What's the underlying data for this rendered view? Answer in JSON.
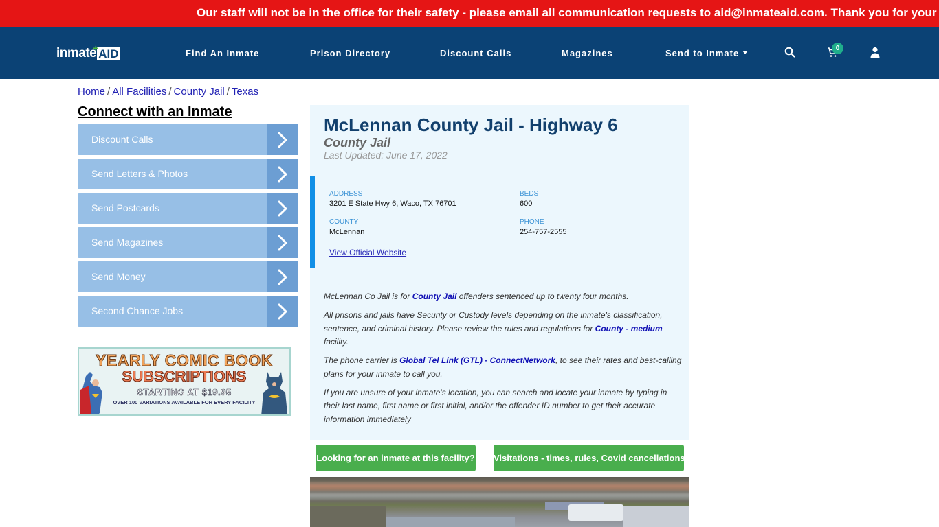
{
  "alert": {
    "text": "Our staff will not be in the office for their safety - please email all communication requests to aid@inmateaid.com. Thank you for your understanding."
  },
  "header": {
    "logo_text_a": "inmate",
    "logo_text_b": "AID",
    "nav": [
      {
        "label": "Find An Inmate"
      },
      {
        "label": "Prison Directory"
      },
      {
        "label": "Discount Calls"
      },
      {
        "label": "Magazines"
      },
      {
        "label": "Send to Inmate",
        "has_dropdown": true
      }
    ],
    "icons": {
      "search": "search-icon",
      "cart": "cart-icon",
      "user": "user-icon"
    },
    "cart_count": "0"
  },
  "breadcrumb": [
    {
      "label": "Home"
    },
    {
      "label": "All Facilities"
    },
    {
      "label": "County Jail"
    },
    {
      "label": "Texas"
    }
  ],
  "sidebar": {
    "title": "Connect with an Inmate",
    "items": [
      {
        "label": "Discount Calls"
      },
      {
        "label": "Send Letters & Photos"
      },
      {
        "label": "Send Postcards"
      },
      {
        "label": "Send Magazines"
      },
      {
        "label": "Send Money"
      },
      {
        "label": "Second Chance Jobs"
      }
    ],
    "banner": {
      "line1": "YEARLY COMIC BOOK",
      "line2": "SUBSCRIPTIONS",
      "line3": "STARTING AT $19.95",
      "line4": "OVER 100 VARIATIONS AVAILABLE FOR EVERY FACILITY"
    }
  },
  "facility": {
    "name": "McLennan County Jail - Highway 6",
    "type": "County Jail",
    "last_updated": "Last Updated: June 17, 2022",
    "address_label": "ADDRESS",
    "address": "3201 E State Hwy 6, Waco, TX 76701",
    "beds_label": "BEDS",
    "beds": "600",
    "county_label": "COUNTY",
    "county": "McLennan",
    "phone_label": "PHONE",
    "phone": "254-757-2555",
    "website_link": "View Official Website"
  },
  "description": {
    "p1_a": "McLennan Co Jail is for ",
    "p1_link": "County Jail",
    "p1_b": " offenders sentenced up to twenty four months.",
    "p2_a": "All prisons and jails have Security or Custody levels depending on the inmate's classification, sentence, and criminal history. Please review the rules and regulations for ",
    "p2_link": "County - medium",
    "p2_b": " facility.",
    "p3_a": "The phone carrier is ",
    "p3_link": "Global Tel Link (GTL) - ConnectNetwork",
    "p3_b": ", to see their rates and best-calling plans for your inmate to call you.",
    "p4": "If you are unsure of your inmate's location, you can search and locate your inmate by typing in their last name, first name or first initial, and/or the offender ID number to get their accurate information immediately"
  },
  "actions": {
    "find_inmate": "Looking for an inmate at this facility?",
    "visitations": "Visitations - times, rules, Covid cancellations"
  },
  "colors": {
    "alert_bg": "#e51515",
    "nav_bg": "#0b4275",
    "accent_blue": "#118fe6",
    "button_green": "#49ae4d",
    "cart_badge": "#1fae8c"
  }
}
